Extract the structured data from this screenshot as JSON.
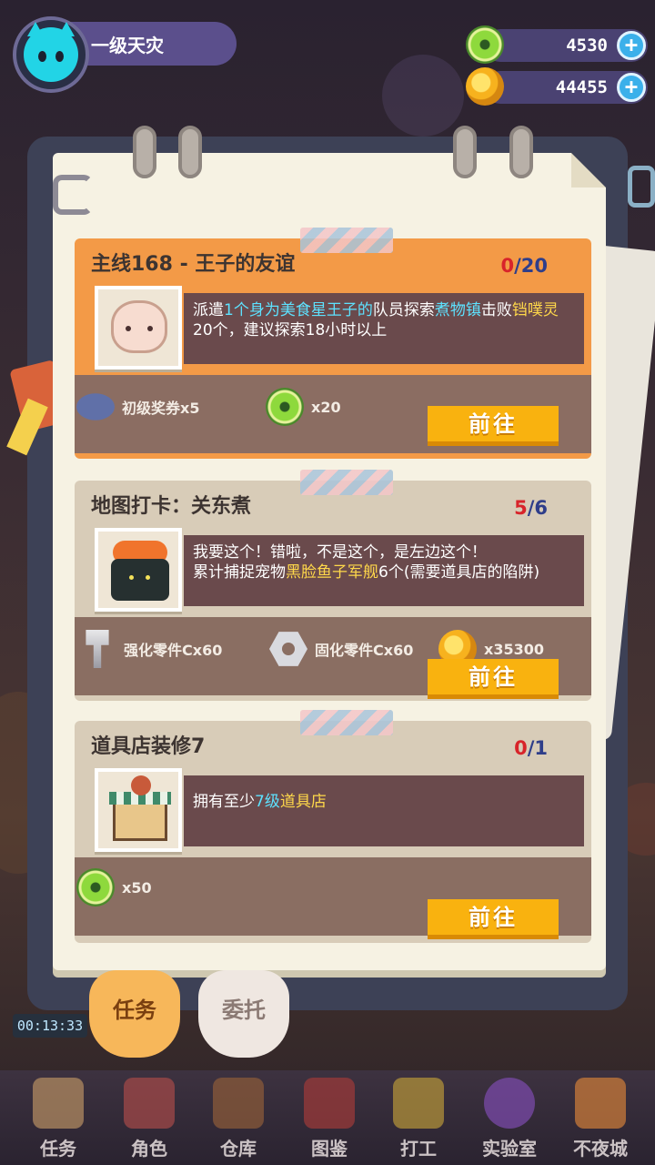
{
  "player": {
    "name": "一级天灾",
    "avatar_icon": "cat-face-icon"
  },
  "currencies": [
    {
      "icon": "green-donut-icon",
      "amount": "4530"
    },
    {
      "icon": "gold-coin-icon",
      "amount": "44455"
    }
  ],
  "quests": [
    {
      "title": "主线168 - 王子的友谊",
      "progress_current": "0",
      "progress_total": "/20",
      "thumb_icon": "dumpling-icon",
      "desc_parts": [
        {
          "text": "派遣",
          "hl": ""
        },
        {
          "text": "1个身为美食星王子的",
          "hl": "cyan"
        },
        {
          "text": "队员探索",
          "hl": ""
        },
        {
          "text": "煮物镇",
          "hl": "cyan"
        },
        {
          "text": "击败",
          "hl": ""
        },
        {
          "text": "铛噗灵",
          "hl": "yellow"
        },
        {
          "text": "20个，建议探索18小时以上",
          "hl": ""
        }
      ],
      "rewards": [
        {
          "icon": "ticket-icon",
          "label": "初级奖券x5"
        },
        {
          "icon": "green-donut-icon",
          "label": "x20"
        }
      ],
      "button": "前往"
    },
    {
      "title": "地图打卡：关东煮",
      "progress_current": "5",
      "progress_total": "/6",
      "thumb_icon": "sushi-icon",
      "desc_parts": [
        {
          "text": "我要这个！错啦，不是这个，是左边这个！",
          "hl": ""
        },
        {
          "text": "累计捕捉宠物",
          "hl": ""
        },
        {
          "text": "黑脸鱼子军舰",
          "hl": "yellow"
        },
        {
          "text": "6个(需要道具店的陷阱)",
          "hl": ""
        }
      ],
      "rewards": [
        {
          "icon": "bolt-icon",
          "label": "强化零件Cx60"
        },
        {
          "icon": "nut-icon",
          "label": "固化零件Cx60"
        },
        {
          "icon": "gold-coin-icon",
          "label": "x35300"
        }
      ],
      "button": "前往"
    },
    {
      "title": "道具店装修7",
      "progress_current": "0",
      "progress_total": "/1",
      "thumb_icon": "shop-icon",
      "desc_parts": [
        {
          "text": "拥有至少",
          "hl": ""
        },
        {
          "text": "7级",
          "hl": "cyan"
        },
        {
          "text": "道具店",
          "hl": "yellow"
        }
      ],
      "rewards": [
        {
          "icon": "green-donut-icon",
          "label": "x50"
        }
      ],
      "button": "前往"
    }
  ],
  "paw_tabs": [
    {
      "label": "任务",
      "active": true
    },
    {
      "label": "委托",
      "active": false
    }
  ],
  "timer": "00:13:33",
  "nav": [
    {
      "label": "任务",
      "icon": "clipboard-icon"
    },
    {
      "label": "角色",
      "icon": "cat-card-icon"
    },
    {
      "label": "仓库",
      "icon": "chest-icon"
    },
    {
      "label": "图鉴",
      "icon": "book-icon"
    },
    {
      "label": "打工",
      "icon": "tv-icon"
    },
    {
      "label": "实验室",
      "icon": "flask-icon"
    },
    {
      "label": "不夜城",
      "icon": "fox-icon"
    }
  ]
}
